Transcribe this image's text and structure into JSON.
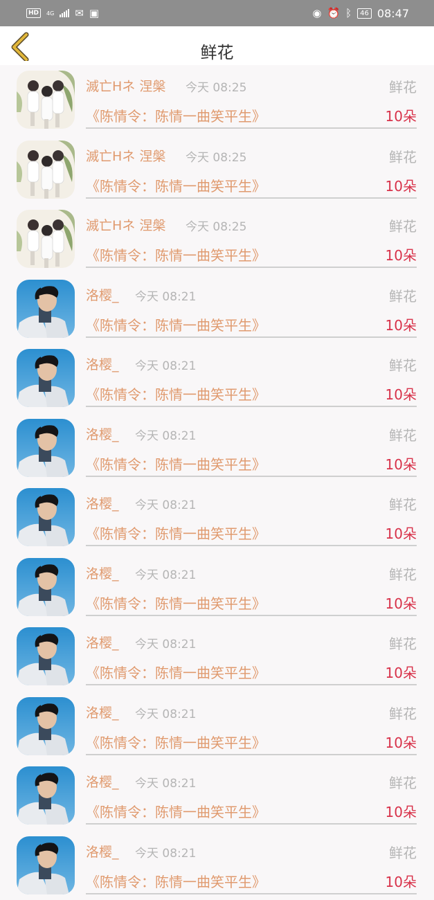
{
  "status_bar": {
    "hd": "HD",
    "network": "4G",
    "battery": "46",
    "time": "08:47"
  },
  "header": {
    "title": "鲜花",
    "back_icon": "chevron-left-icon"
  },
  "colors": {
    "accent": "#e09a6e",
    "count": "#d8324a",
    "muted": "#b5b5b5",
    "back_icon": "#e2b73a"
  },
  "rows": [
    {
      "avatar": "group-photo",
      "name": "滅亡Hネ 涅槃",
      "time": "今天 08:25",
      "type": "鲜花",
      "title": "《陈情令：陈情一曲笑平生》",
      "count": "10朵"
    },
    {
      "avatar": "group-photo",
      "name": "滅亡Hネ 涅槃",
      "time": "今天 08:25",
      "type": "鲜花",
      "title": "《陈情令：陈情一曲笑平生》",
      "count": "10朵"
    },
    {
      "avatar": "group-photo",
      "name": "滅亡Hネ 涅槃",
      "time": "今天 08:25",
      "type": "鲜花",
      "title": "《陈情令：陈情一曲笑平生》",
      "count": "10朵"
    },
    {
      "avatar": "portrait-photo",
      "name": "洛樱_",
      "time": "今天 08:21",
      "type": "鲜花",
      "title": "《陈情令：陈情一曲笑平生》",
      "count": "10朵"
    },
    {
      "avatar": "portrait-photo",
      "name": "洛樱_",
      "time": "今天 08:21",
      "type": "鲜花",
      "title": "《陈情令：陈情一曲笑平生》",
      "count": "10朵"
    },
    {
      "avatar": "portrait-photo",
      "name": "洛樱_",
      "time": "今天 08:21",
      "type": "鲜花",
      "title": "《陈情令：陈情一曲笑平生》",
      "count": "10朵"
    },
    {
      "avatar": "portrait-photo",
      "name": "洛樱_",
      "time": "今天 08:21",
      "type": "鲜花",
      "title": "《陈情令：陈情一曲笑平生》",
      "count": "10朵"
    },
    {
      "avatar": "portrait-photo",
      "name": "洛樱_",
      "time": "今天 08:21",
      "type": "鲜花",
      "title": "《陈情令：陈情一曲笑平生》",
      "count": "10朵"
    },
    {
      "avatar": "portrait-photo",
      "name": "洛樱_",
      "time": "今天 08:21",
      "type": "鲜花",
      "title": "《陈情令：陈情一曲笑平生》",
      "count": "10朵"
    },
    {
      "avatar": "portrait-photo",
      "name": "洛樱_",
      "time": "今天 08:21",
      "type": "鲜花",
      "title": "《陈情令：陈情一曲笑平生》",
      "count": "10朵"
    },
    {
      "avatar": "portrait-photo",
      "name": "洛樱_",
      "time": "今天 08:21",
      "type": "鲜花",
      "title": "《陈情令：陈情一曲笑平生》",
      "count": "10朵"
    },
    {
      "avatar": "portrait-photo",
      "name": "洛樱_",
      "time": "今天 08:21",
      "type": "鲜花",
      "title": "《陈情令：陈情一曲笑平生》",
      "count": "10朵"
    }
  ]
}
